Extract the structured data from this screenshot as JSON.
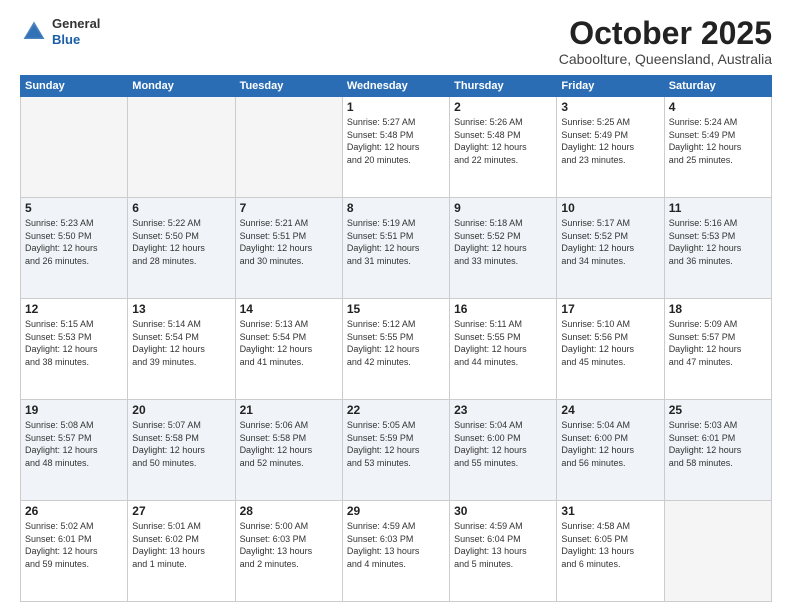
{
  "logo": {
    "general": "General",
    "blue": "Blue"
  },
  "header": {
    "month": "October 2025",
    "location": "Caboolture, Queensland, Australia"
  },
  "weekdays": [
    "Sunday",
    "Monday",
    "Tuesday",
    "Wednesday",
    "Thursday",
    "Friday",
    "Saturday"
  ],
  "weeks": [
    [
      {
        "day": "",
        "info": ""
      },
      {
        "day": "",
        "info": ""
      },
      {
        "day": "",
        "info": ""
      },
      {
        "day": "1",
        "info": "Sunrise: 5:27 AM\nSunset: 5:48 PM\nDaylight: 12 hours\nand 20 minutes."
      },
      {
        "day": "2",
        "info": "Sunrise: 5:26 AM\nSunset: 5:48 PM\nDaylight: 12 hours\nand 22 minutes."
      },
      {
        "day": "3",
        "info": "Sunrise: 5:25 AM\nSunset: 5:49 PM\nDaylight: 12 hours\nand 23 minutes."
      },
      {
        "day": "4",
        "info": "Sunrise: 5:24 AM\nSunset: 5:49 PM\nDaylight: 12 hours\nand 25 minutes."
      }
    ],
    [
      {
        "day": "5",
        "info": "Sunrise: 5:23 AM\nSunset: 5:50 PM\nDaylight: 12 hours\nand 26 minutes."
      },
      {
        "day": "6",
        "info": "Sunrise: 5:22 AM\nSunset: 5:50 PM\nDaylight: 12 hours\nand 28 minutes."
      },
      {
        "day": "7",
        "info": "Sunrise: 5:21 AM\nSunset: 5:51 PM\nDaylight: 12 hours\nand 30 minutes."
      },
      {
        "day": "8",
        "info": "Sunrise: 5:19 AM\nSunset: 5:51 PM\nDaylight: 12 hours\nand 31 minutes."
      },
      {
        "day": "9",
        "info": "Sunrise: 5:18 AM\nSunset: 5:52 PM\nDaylight: 12 hours\nand 33 minutes."
      },
      {
        "day": "10",
        "info": "Sunrise: 5:17 AM\nSunset: 5:52 PM\nDaylight: 12 hours\nand 34 minutes."
      },
      {
        "day": "11",
        "info": "Sunrise: 5:16 AM\nSunset: 5:53 PM\nDaylight: 12 hours\nand 36 minutes."
      }
    ],
    [
      {
        "day": "12",
        "info": "Sunrise: 5:15 AM\nSunset: 5:53 PM\nDaylight: 12 hours\nand 38 minutes."
      },
      {
        "day": "13",
        "info": "Sunrise: 5:14 AM\nSunset: 5:54 PM\nDaylight: 12 hours\nand 39 minutes."
      },
      {
        "day": "14",
        "info": "Sunrise: 5:13 AM\nSunset: 5:54 PM\nDaylight: 12 hours\nand 41 minutes."
      },
      {
        "day": "15",
        "info": "Sunrise: 5:12 AM\nSunset: 5:55 PM\nDaylight: 12 hours\nand 42 minutes."
      },
      {
        "day": "16",
        "info": "Sunrise: 5:11 AM\nSunset: 5:55 PM\nDaylight: 12 hours\nand 44 minutes."
      },
      {
        "day": "17",
        "info": "Sunrise: 5:10 AM\nSunset: 5:56 PM\nDaylight: 12 hours\nand 45 minutes."
      },
      {
        "day": "18",
        "info": "Sunrise: 5:09 AM\nSunset: 5:57 PM\nDaylight: 12 hours\nand 47 minutes."
      }
    ],
    [
      {
        "day": "19",
        "info": "Sunrise: 5:08 AM\nSunset: 5:57 PM\nDaylight: 12 hours\nand 48 minutes."
      },
      {
        "day": "20",
        "info": "Sunrise: 5:07 AM\nSunset: 5:58 PM\nDaylight: 12 hours\nand 50 minutes."
      },
      {
        "day": "21",
        "info": "Sunrise: 5:06 AM\nSunset: 5:58 PM\nDaylight: 12 hours\nand 52 minutes."
      },
      {
        "day": "22",
        "info": "Sunrise: 5:05 AM\nSunset: 5:59 PM\nDaylight: 12 hours\nand 53 minutes."
      },
      {
        "day": "23",
        "info": "Sunrise: 5:04 AM\nSunset: 6:00 PM\nDaylight: 12 hours\nand 55 minutes."
      },
      {
        "day": "24",
        "info": "Sunrise: 5:04 AM\nSunset: 6:00 PM\nDaylight: 12 hours\nand 56 minutes."
      },
      {
        "day": "25",
        "info": "Sunrise: 5:03 AM\nSunset: 6:01 PM\nDaylight: 12 hours\nand 58 minutes."
      }
    ],
    [
      {
        "day": "26",
        "info": "Sunrise: 5:02 AM\nSunset: 6:01 PM\nDaylight: 12 hours\nand 59 minutes."
      },
      {
        "day": "27",
        "info": "Sunrise: 5:01 AM\nSunset: 6:02 PM\nDaylight: 13 hours\nand 1 minute."
      },
      {
        "day": "28",
        "info": "Sunrise: 5:00 AM\nSunset: 6:03 PM\nDaylight: 13 hours\nand 2 minutes."
      },
      {
        "day": "29",
        "info": "Sunrise: 4:59 AM\nSunset: 6:03 PM\nDaylight: 13 hours\nand 4 minutes."
      },
      {
        "day": "30",
        "info": "Sunrise: 4:59 AM\nSunset: 6:04 PM\nDaylight: 13 hours\nand 5 minutes."
      },
      {
        "day": "31",
        "info": "Sunrise: 4:58 AM\nSunset: 6:05 PM\nDaylight: 13 hours\nand 6 minutes."
      },
      {
        "day": "",
        "info": ""
      }
    ]
  ]
}
